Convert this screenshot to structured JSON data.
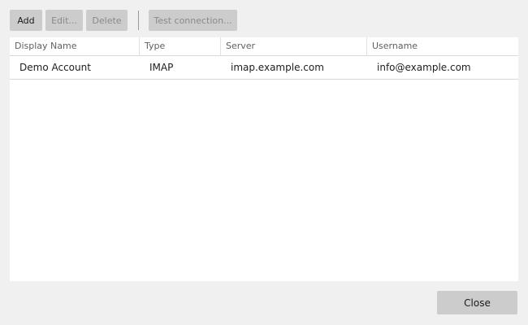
{
  "toolbar": {
    "add_label": "Add",
    "edit_label": "Edit...",
    "delete_label": "Delete",
    "test_label": "Test connection..."
  },
  "table": {
    "columns": [
      "Display Name",
      "Type",
      "Server",
      "Username"
    ],
    "rows": [
      {
        "display_name": "Demo Account",
        "type": "IMAP",
        "server": "imap.example.com",
        "username": "info@example.com"
      }
    ]
  },
  "footer": {
    "close_label": "Close"
  }
}
